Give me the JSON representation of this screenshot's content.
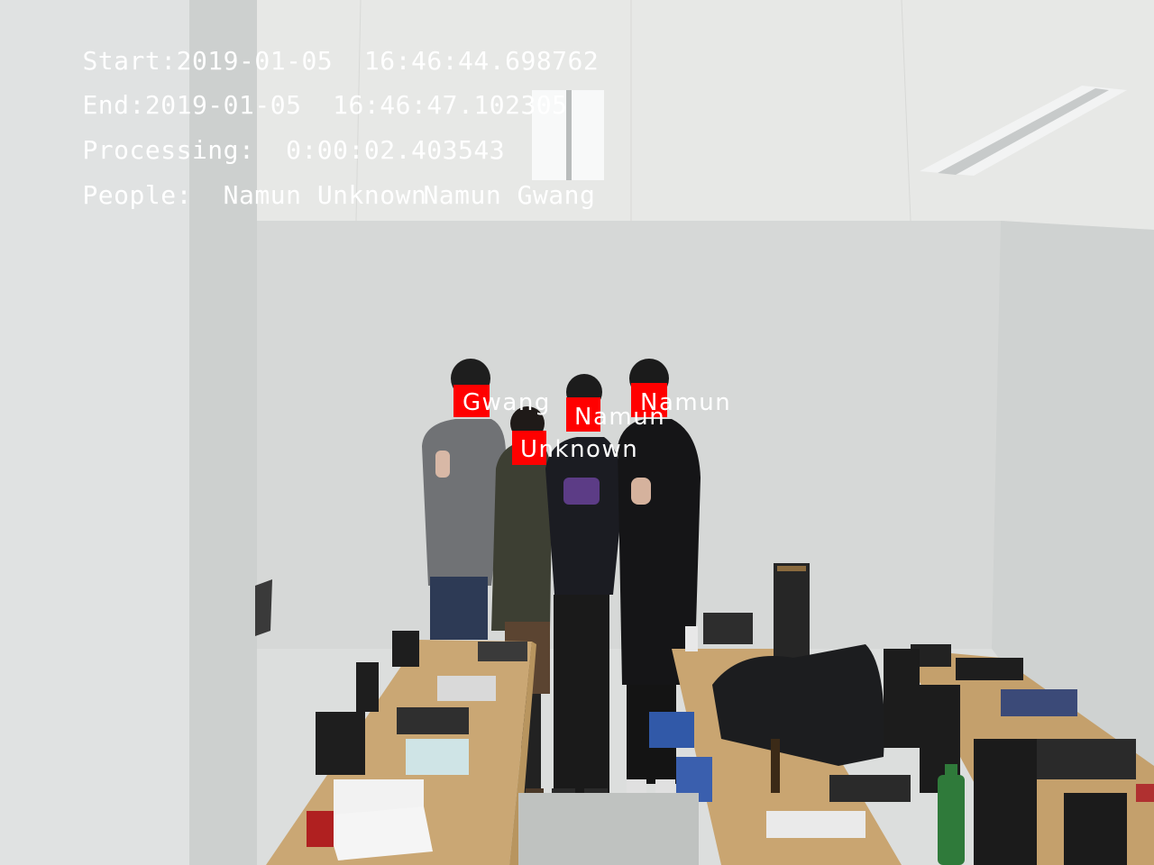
{
  "overlay": {
    "start_label": "Start:",
    "start_value": "2019-01-05  16:46:44.698762",
    "end_label": "End:",
    "end_value": "2019-01-05  16:46:47.102305",
    "processing_label": "Processing:",
    "processing_value": "0:00:02.403543",
    "people_label": "People:",
    "people_value": "Namun Unknown",
    "people_value_overlap": "Namun Gwang"
  },
  "detections": [
    {
      "name": "Gwang"
    },
    {
      "name": "Namun"
    },
    {
      "name": "Unknown"
    },
    {
      "name": "Namun"
    }
  ],
  "colors": {
    "box": "#ff0000",
    "text": "#ffffff"
  }
}
